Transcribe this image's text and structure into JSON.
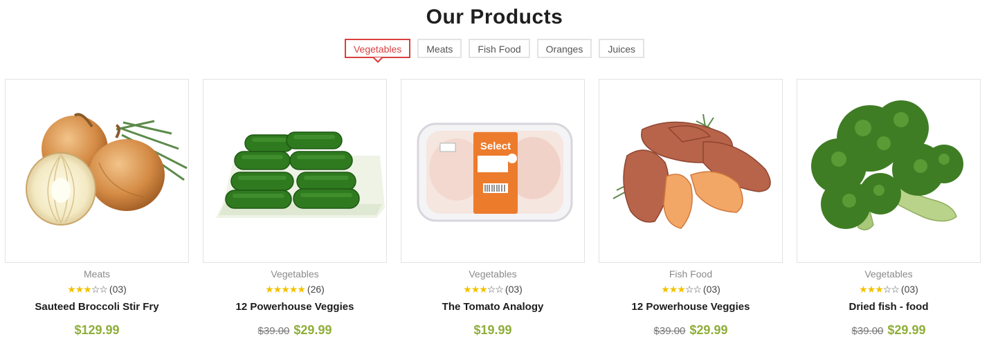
{
  "section": {
    "title": "Our Products"
  },
  "tabs": [
    {
      "label": "Vegetables",
      "active": true
    },
    {
      "label": "Meats",
      "active": false
    },
    {
      "label": "Fish Food",
      "active": false
    },
    {
      "label": "Oranges",
      "active": false
    },
    {
      "label": "Juices",
      "active": false
    }
  ],
  "products": [
    {
      "image": "onion-image",
      "category": "Meats",
      "rating": 3,
      "rating_max": 5,
      "reviews": "(03)",
      "name": "Sauteed Broccoli Stir Fry",
      "old_price": "",
      "price": "$129.99"
    },
    {
      "image": "cucumber-image",
      "category": "Vegetables",
      "rating": 5,
      "rating_max": 5,
      "reviews": "(26)",
      "name": "12 Powerhouse Veggies",
      "old_price": "$39.00",
      "price": "$29.99"
    },
    {
      "image": "chicken-pack-image",
      "category": "Vegetables",
      "rating": 3,
      "rating_max": 5,
      "reviews": "(03)",
      "name": "The Tomato Analogy",
      "old_price": "",
      "price": "$19.99",
      "package_label": "Select"
    },
    {
      "image": "sweet-potato-image",
      "category": "Fish Food",
      "rating": 3,
      "rating_max": 5,
      "reviews": "(03)",
      "name": "12 Powerhouse Veggies",
      "old_price": "$39.00",
      "price": "$29.99"
    },
    {
      "image": "broccoli-image",
      "category": "Vegetables",
      "rating": 3,
      "rating_max": 5,
      "reviews": "(03)",
      "name": "Dried fish - food",
      "old_price": "$39.00",
      "price": "$29.99"
    }
  ],
  "colors": {
    "accent": "#d93f3f",
    "price": "#8fae3a",
    "star": "#f2c200"
  }
}
